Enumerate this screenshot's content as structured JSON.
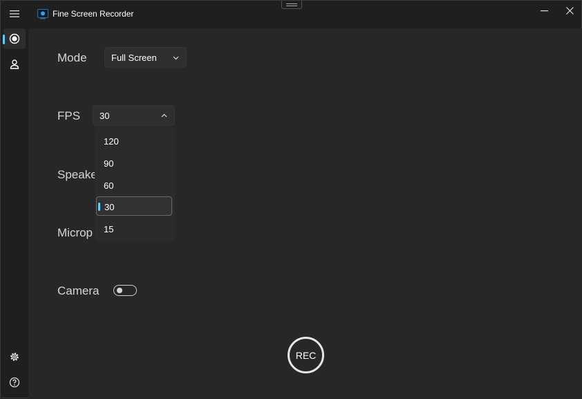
{
  "app": {
    "title": "Fine Screen Recorder"
  },
  "nav": [
    {
      "icon": "record-icon",
      "active": true
    },
    {
      "icon": "person-icon",
      "active": false
    }
  ],
  "nav_bottom": [
    {
      "icon": "gear-icon"
    },
    {
      "icon": "help-icon"
    }
  ],
  "settings": {
    "mode": {
      "label": "Mode",
      "value": "Full Screen"
    },
    "fps": {
      "label": "FPS",
      "value": "30",
      "options": [
        "120",
        "90",
        "60",
        "30",
        "15"
      ],
      "selected": "30"
    },
    "speaker": {
      "label": "Speake"
    },
    "microphone": {
      "label": "Microp"
    },
    "camera": {
      "label": "Camera",
      "enabled": false
    }
  },
  "rec_label": "REC",
  "colors": {
    "accent": "#60cdff",
    "background": "#272727",
    "titlebar": "#1f1f1f"
  }
}
